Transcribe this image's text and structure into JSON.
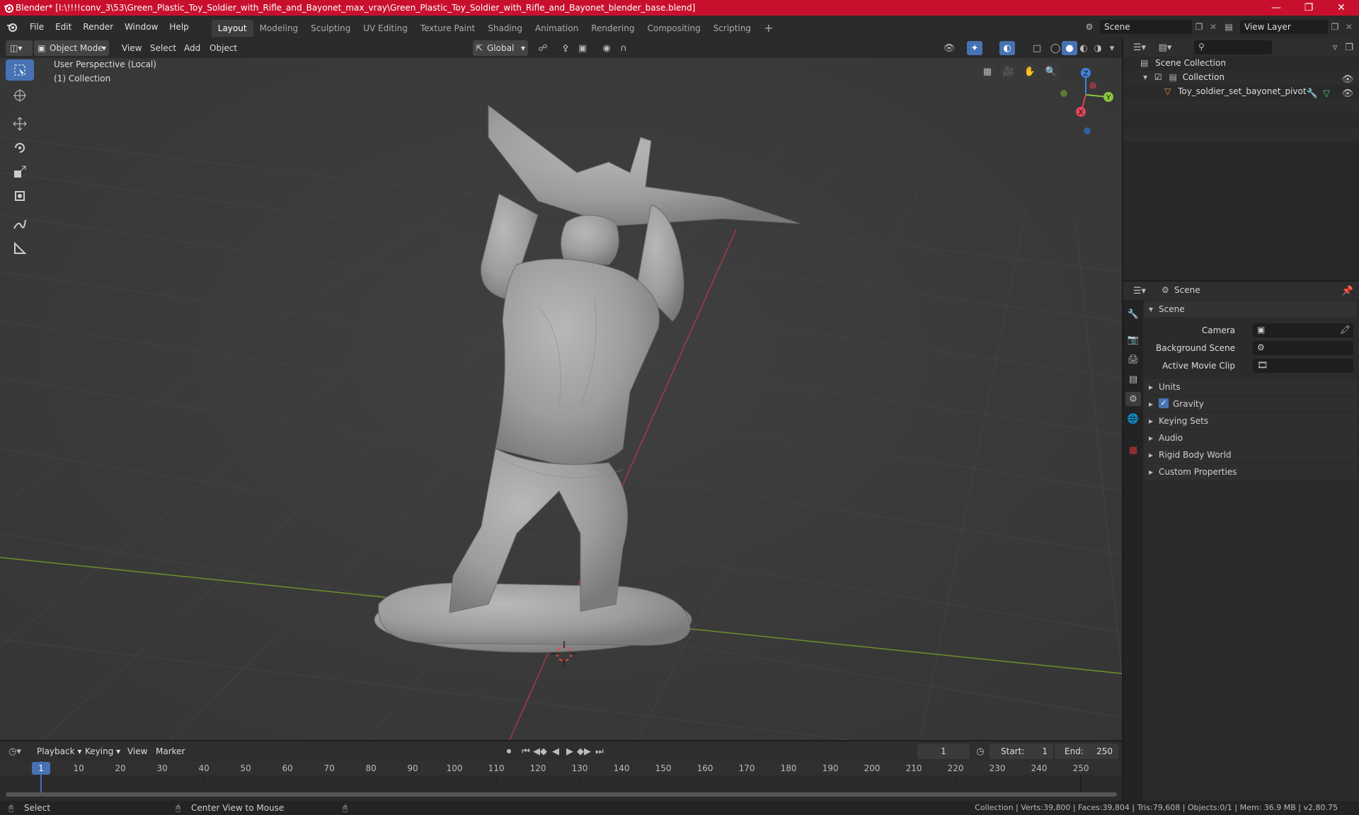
{
  "titlebar": {
    "title": "Blender* [I:\\!!!!conv_3\\53\\Green_Plastic_Toy_Soldier_with_Rifle_and_Bayonet_max_vray\\Green_Plastic_Toy_Soldier_with_Rifle_and_Bayonet_blender_base.blend]",
    "color": "#c8102e"
  },
  "menus": [
    "File",
    "Edit",
    "Render",
    "Window",
    "Help"
  ],
  "workspaces": [
    "Layout",
    "Modeling",
    "Sculpting",
    "UV Editing",
    "Texture Paint",
    "Shading",
    "Animation",
    "Rendering",
    "Compositing",
    "Scripting"
  ],
  "active_workspace": "Layout",
  "scene_selector": "Scene",
  "view_layer_selector": "View Layer",
  "viewport_header": {
    "mode": "Object Mode",
    "menus": [
      "View",
      "Select",
      "Add",
      "Object"
    ],
    "transform_orientation": "Global"
  },
  "viewport": {
    "perspective_label": "User Perspective (Local)",
    "collection_label": "(1) Collection",
    "gizmo_axes": {
      "x": "X",
      "y": "Y",
      "z": "Z"
    },
    "x_axis_color": "#e0455a",
    "y_axis_color": "#8bc440",
    "z_axis_color": "#3f82e0"
  },
  "outliner": {
    "root": "Scene Collection",
    "collection": "Collection",
    "object": "Toy_soldier_set_bayonet_pivot"
  },
  "properties": {
    "header": "Scene",
    "panel_title": "Scene",
    "camera_label": "Camera",
    "background_scene_label": "Background Scene",
    "active_clip_label": "Active Movie Clip",
    "sections": [
      "Units",
      "Gravity",
      "Keying Sets",
      "Audio",
      "Rigid Body World",
      "Custom Properties"
    ],
    "gravity_checked": true
  },
  "timeline": {
    "menus": [
      "Playback",
      "Keying",
      "View",
      "Marker"
    ],
    "current_frame": "1",
    "start_label": "Start:",
    "start_value": "1",
    "end_label": "End:",
    "end_value": "250",
    "ticks": [
      "1",
      "10",
      "20",
      "30",
      "40",
      "50",
      "60",
      "70",
      "80",
      "90",
      "100",
      "110",
      "120",
      "130",
      "140",
      "150",
      "160",
      "170",
      "180",
      "190",
      "200",
      "210",
      "220",
      "230",
      "240",
      "250"
    ]
  },
  "statusbar": {
    "left_hint": "Select",
    "middle_hint": "Center View to Mouse",
    "stats": "Collection | Verts:39,800 | Faces:39,804 | Tris:79,608 | Objects:0/1 | Mem: 36.9 MB | v2.80.75"
  }
}
